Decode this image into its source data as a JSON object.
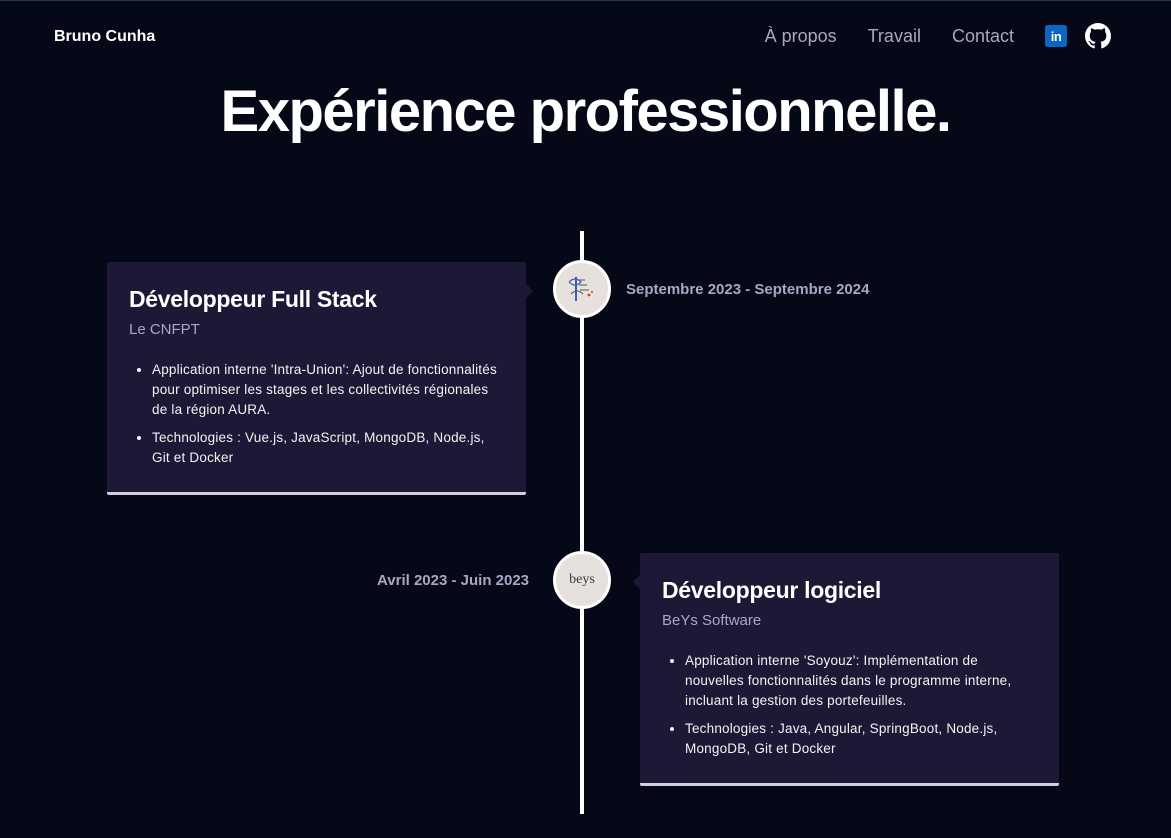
{
  "header": {
    "brand": "Bruno Cunha",
    "nav": [
      "À propos",
      "Travail",
      "Contact"
    ],
    "linkedin_label": "in"
  },
  "page": {
    "title": "Expérience professionnelle."
  },
  "experiences": [
    {
      "title": "Développeur Full Stack",
      "company": "Le CNFPT",
      "date": "Septembre 2023 - Septembre 2024",
      "points": [
        "Application interne 'Intra-Union': Ajout de fonctionnalités pour optimiser les stages et les collectivités régionales de la région AURA.",
        "Technologies : Vue.js, JavaScript, MongoDB, Node.js, Git et Docker"
      ]
    },
    {
      "title": "Développeur logiciel",
      "company": "BeYs Software",
      "date": "Avril 2023 - Juin 2023",
      "logo_text": "beys",
      "points": [
        "Application interne 'Soyouz': Implémentation de nouvelles fonctionnalités dans le programme interne, incluant la gestion des portefeuilles.",
        "Technologies : Java, Angular, SpringBoot, Node.js, MongoDB, Git et Docker"
      ]
    }
  ],
  "colors": {
    "background": "#050816",
    "card": "#1d1836",
    "secondary_text": "#aaa6c3",
    "linkedin": "#0a66c2"
  },
  "icons": [
    "linkedin-icon",
    "github-icon",
    "cnfpt-logo-icon",
    "beys-logo-icon"
  ]
}
